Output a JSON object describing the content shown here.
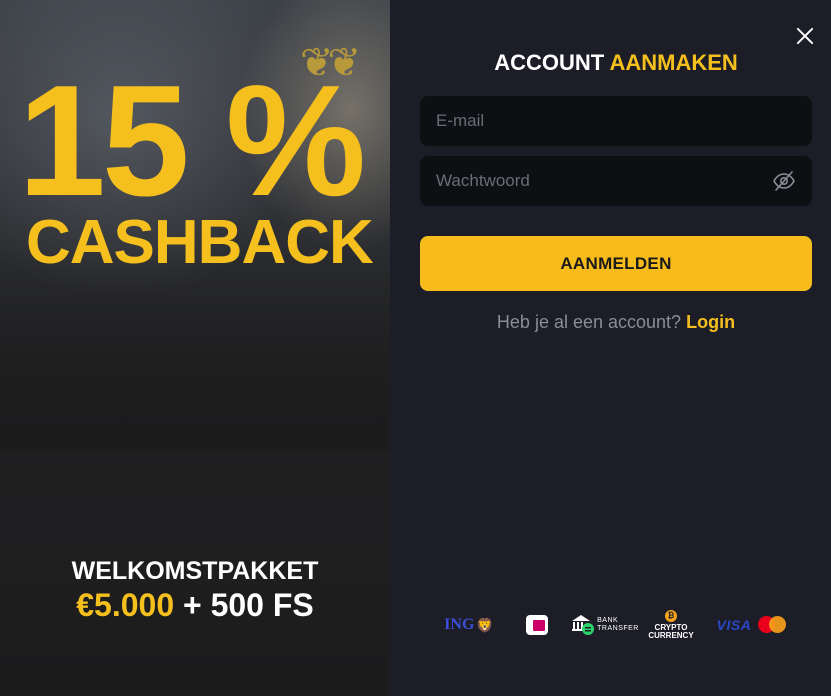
{
  "promo": {
    "percent": "15 %",
    "cashback": "CASHBACK",
    "welcome": "WELKOMSTPAKKET",
    "bonus_amount": "€5.000",
    "bonus_rest": " + 500 FS"
  },
  "form": {
    "title_part1": "ACCOUNT",
    "title_part2": "AANMAKEN",
    "email_placeholder": "E-mail",
    "password_placeholder": "Wachtwoord",
    "submit_label": "AANMELDEN",
    "have_account": "Heb je al een account?",
    "login_link": "Login"
  },
  "payments": {
    "ing": "ING",
    "ideal": "iDEAL",
    "bank_transfer": [
      "BANK",
      "TRANSFER"
    ],
    "crypto": [
      "CRYPTO",
      "CURRENCY"
    ],
    "visa": "VISA",
    "mastercard": "mastercard"
  },
  "colors": {
    "accent": "#f5c01e",
    "button": "#f8bb1c",
    "panel": "#1c1d26",
    "input": "#0e0f13"
  }
}
